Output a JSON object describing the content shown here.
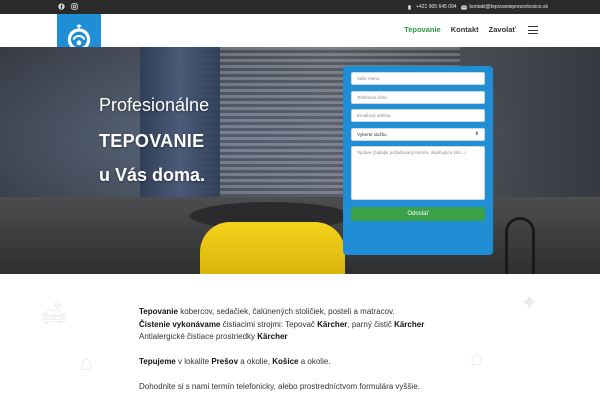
{
  "topbar": {
    "icons": [
      "facebook-icon",
      "instagram-icon"
    ],
    "phone": "+421 905 645 094",
    "email": "kontakt@tepovaniepresovkosice.sk"
  },
  "nav": {
    "items": [
      {
        "label": "Tepovanie",
        "active": true
      },
      {
        "label": "Kontakt",
        "active": false
      },
      {
        "label": "Zavolať",
        "active": false
      }
    ]
  },
  "hero": {
    "line1": "Profesionálne",
    "line2": "TEPOVANIE",
    "line3": "u Vás doma."
  },
  "form": {
    "name_placeholder": "Vaše meno",
    "phone_placeholder": "Telefónne číslo",
    "email_placeholder": "Emailová adresa",
    "service_selected": "Vyberte službu",
    "message_placeholder": "Správa (zadajte požadovaný termín, doplňujúce info...)",
    "submit_label": "Odoslať"
  },
  "content": {
    "p1_bold": "Tepovanie",
    "p1_rest": " kobercov, sedačiek, čalúnených stoličiek, posteli a matracov.",
    "p2_bold": "Čistenie vykonávame",
    "p2_rest": " čistiacimi strojmi:  Tepovač ",
    "p2_karcher1": "Kärcher",
    "p2_mid": ", parný čistič ",
    "p2_karcher2": "Kärcher",
    "p3_rest": "Antialergické čistiace prostriedky ",
    "p3_karcher": "Kärcher",
    "p4_bold": "Tepujeme",
    "p4_mid": " v lokalite ",
    "p4_presov": "Prešov",
    "p4_and": " a okolie, ",
    "p4_kosice": "Košice",
    "p4_end": " a okolie.",
    "p5": "Dohodnite si s nami termín telefonicky, alebo prostredníctvom formulára vyššie."
  },
  "colors": {
    "accent_blue": "#1f8ed4",
    "accent_green": "#2e9b3e",
    "submit_green": "#3aa14a",
    "topbar": "#2a2a2a"
  }
}
